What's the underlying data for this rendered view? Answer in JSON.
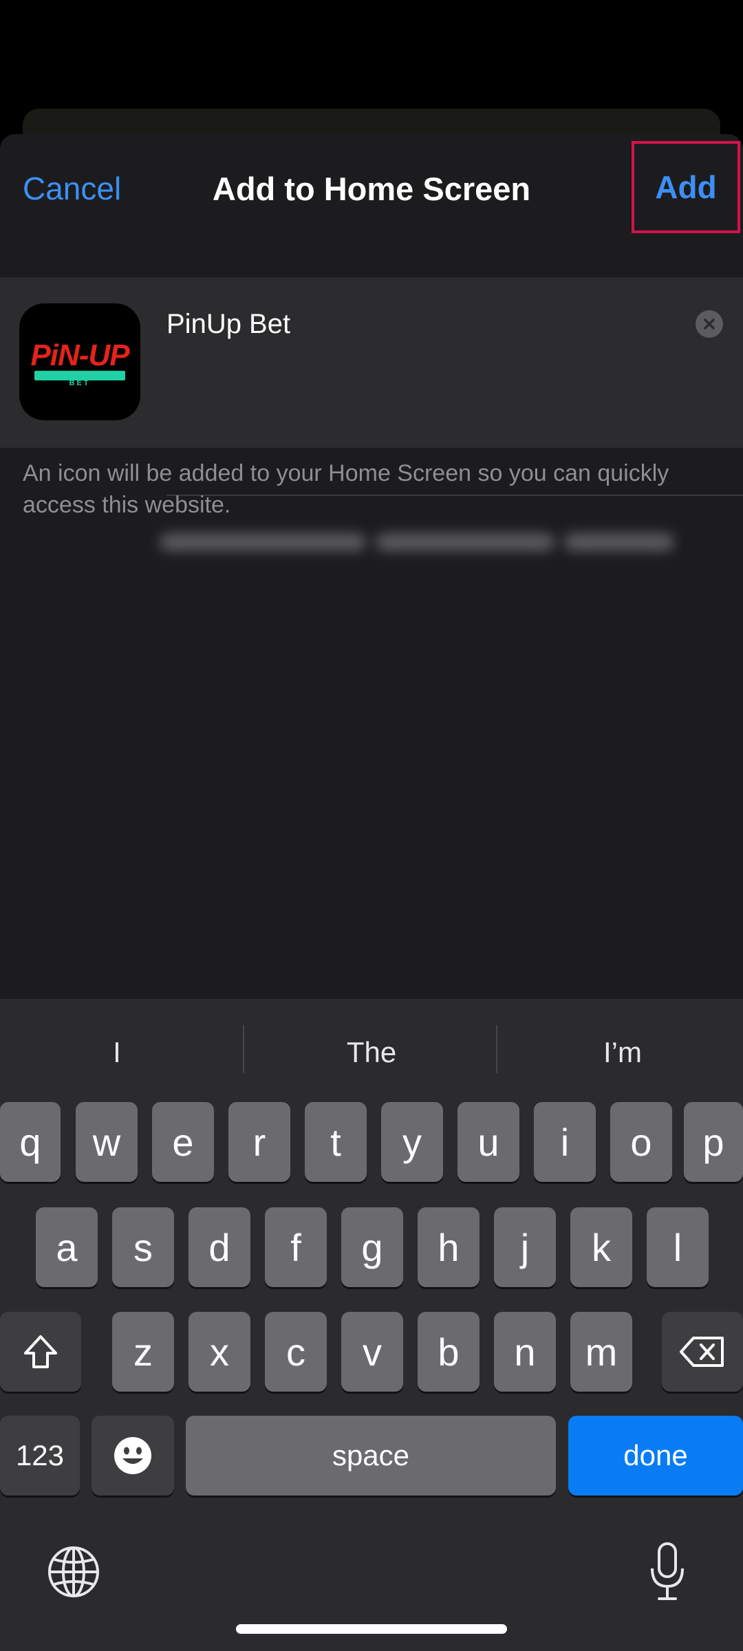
{
  "nav": {
    "cancel_label": "Cancel",
    "title": "Add to Home Screen",
    "add_label": "Add"
  },
  "bookmark": {
    "name_value": "PinUp Bet",
    "logo_text": "PiN-UP",
    "logo_sub": "BET"
  },
  "description": "An icon will be added to your Home Screen so you can quickly access this website.",
  "keyboard": {
    "suggestions": [
      "I",
      "The",
      "I’m"
    ],
    "row1": [
      "q",
      "w",
      "e",
      "r",
      "t",
      "y",
      "u",
      "i",
      "o",
      "p"
    ],
    "row2": [
      "a",
      "s",
      "d",
      "f",
      "g",
      "h",
      "j",
      "k",
      "l"
    ],
    "row3": [
      "z",
      "x",
      "c",
      "v",
      "b",
      "n",
      "m"
    ],
    "numbers_label": "123",
    "space_label": "space",
    "done_label": "done"
  },
  "colors": {
    "accent": "#3d8ff5",
    "highlight_border": "#d4124a",
    "done_key": "#0a7cf3"
  }
}
